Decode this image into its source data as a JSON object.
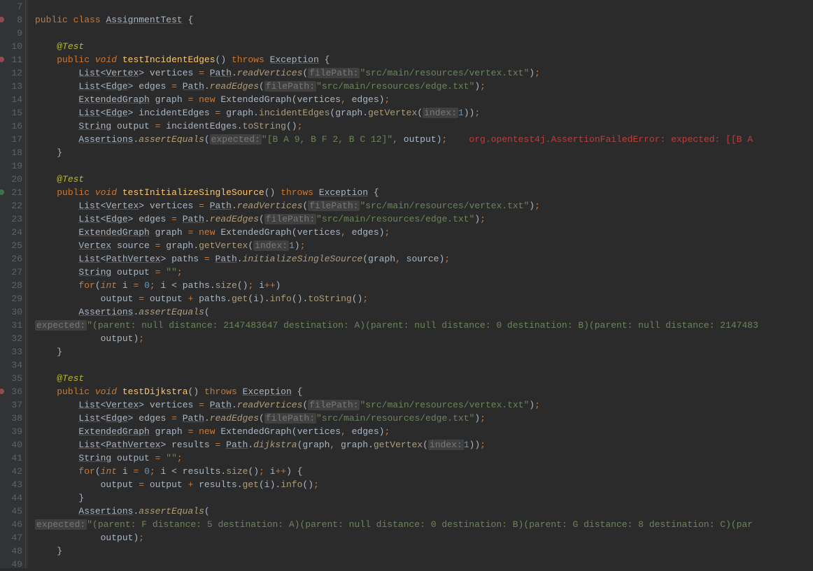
{
  "lines": {
    "l7": "",
    "l8_kw_public": "public",
    "l8_kw_class": "class",
    "l8_class_name": "AssignmentTest",
    "l8_brace": "{",
    "l10_ann": "@Test",
    "l11_kw_public": "public",
    "l11_kw_void": "void",
    "l11_method": "testIncidentEdges",
    "l11_throws": "throws",
    "l11_exc": "Exception",
    "l12_list": "List",
    "l12_vertex": "Vertex",
    "l12_var": "vertices",
    "l12_path": "Path",
    "l12_call": "readVertices",
    "l12_hint": "filePath:",
    "l12_str": "\"src/main/resources/vertex.txt\"",
    "l13_list": "List",
    "l13_edge": "Edge",
    "l13_var": "edges",
    "l13_path": "Path",
    "l13_call": "readEdges",
    "l13_hint": "filePath:",
    "l13_str": "\"src/main/resources/edge.txt\"",
    "l14_type": "ExtendedGraph",
    "l14_var": "graph",
    "l14_new": "new",
    "l14_ctor": "ExtendedGraph",
    "l14_arg1": "vertices",
    "l14_arg2": "edges",
    "l15_list": "List",
    "l15_edge": "Edge",
    "l15_var": "incidentEdges",
    "l15_graph": "graph",
    "l15_call1": "incidentEdges",
    "l15_call2": "getVertex",
    "l15_hint": "index:",
    "l15_num": "1",
    "l16_type": "String",
    "l16_var": "output",
    "l16_in": "incidentEdges",
    "l16_call": "toString",
    "l17_cls": "Assertions",
    "l17_call": "assertEquals",
    "l17_hint": "expected:",
    "l17_str": "\"[B A 9, B F 2, B C 12]\"",
    "l17_arg": "output",
    "l17_err": "org.opentest4j.AssertionFailedError: expected: [[B A",
    "l20_ann": "@Test",
    "l21_kw_public": "public",
    "l21_kw_void": "void",
    "l21_method": "testInitializeSingleSource",
    "l21_throws": "throws",
    "l21_exc": "Exception",
    "l25_type": "Vertex",
    "l25_var": "source",
    "l25_graph": "graph",
    "l25_call": "getVertex",
    "l25_hint": "index:",
    "l25_num": "1",
    "l26_list": "List",
    "l26_pv": "PathVertex",
    "l26_var": "paths",
    "l26_path": "Path",
    "l26_call": "initializeSingleSource",
    "l26_arg1": "graph",
    "l26_arg2": "source",
    "l27_type": "String",
    "l27_var": "output",
    "l27_str": "\"\"",
    "l28_for": "for",
    "l28_int": "int",
    "l28_i": "i",
    "l28_zero": "0",
    "l28_paths": "paths",
    "l28_size": "size",
    "l29_output": "output",
    "l29_paths": "paths",
    "l29_get": "get",
    "l29_i": "i",
    "l29_info": "info",
    "l29_toString": "toString",
    "l30_cls": "Assertions",
    "l30_call": "assertEquals",
    "l31_hint": "expected:",
    "l31_str": "\"(parent: null distance: 2147483647 destination: A)(parent: null distance: 0 destination: B)(parent: null distance: 2147483",
    "l32_output": "output",
    "l35_ann": "@Test",
    "l36_kw_public": "public",
    "l36_kw_void": "void",
    "l36_method": "testDijkstra",
    "l36_throws": "throws",
    "l36_exc": "Exception",
    "l40_list": "List",
    "l40_pv": "PathVertex",
    "l40_var": "results",
    "l40_path": "Path",
    "l40_call": "dijkstra",
    "l40_arg1": "graph",
    "l40_graph2": "graph",
    "l40_getV": "getVertex",
    "l40_hint": "index:",
    "l40_num": "1",
    "l41_type": "String",
    "l41_var": "output",
    "l41_str": "\"\"",
    "l42_for": "for",
    "l42_int": "int",
    "l42_results": "results",
    "l42_size": "size",
    "l43_output": "output",
    "l43_results": "results",
    "l43_get": "get",
    "l43_info": "info",
    "l45_cls": "Assertions",
    "l45_call": "assertEquals",
    "l46_hint": "expected:",
    "l46_str": "\"(parent: F distance: 5 destination: A)(parent: null distance: 0 destination: B)(parent: G distance: 8 destination: C)(par",
    "l47_output": "output"
  },
  "symbols": {
    "eq": "=",
    "lt": "<",
    "gt": ">",
    "lparen": "(",
    "rparen": ")",
    "lbrace": "{",
    "rbrace": "}",
    "semi": ";",
    "comma": ",",
    "dot": ".",
    "plus": "+",
    "plusplus": "++"
  },
  "line_numbers": [
    "7",
    "8",
    "9",
    "10",
    "11",
    "12",
    "13",
    "14",
    "15",
    "16",
    "17",
    "18",
    "19",
    "20",
    "21",
    "22",
    "23",
    "24",
    "25",
    "26",
    "27",
    "28",
    "29",
    "30",
    "31",
    "32",
    "33",
    "34",
    "35",
    "36",
    "37",
    "38",
    "39",
    "40",
    "41",
    "42",
    "43",
    "44",
    "45",
    "46",
    "47",
    "48",
    "49"
  ]
}
